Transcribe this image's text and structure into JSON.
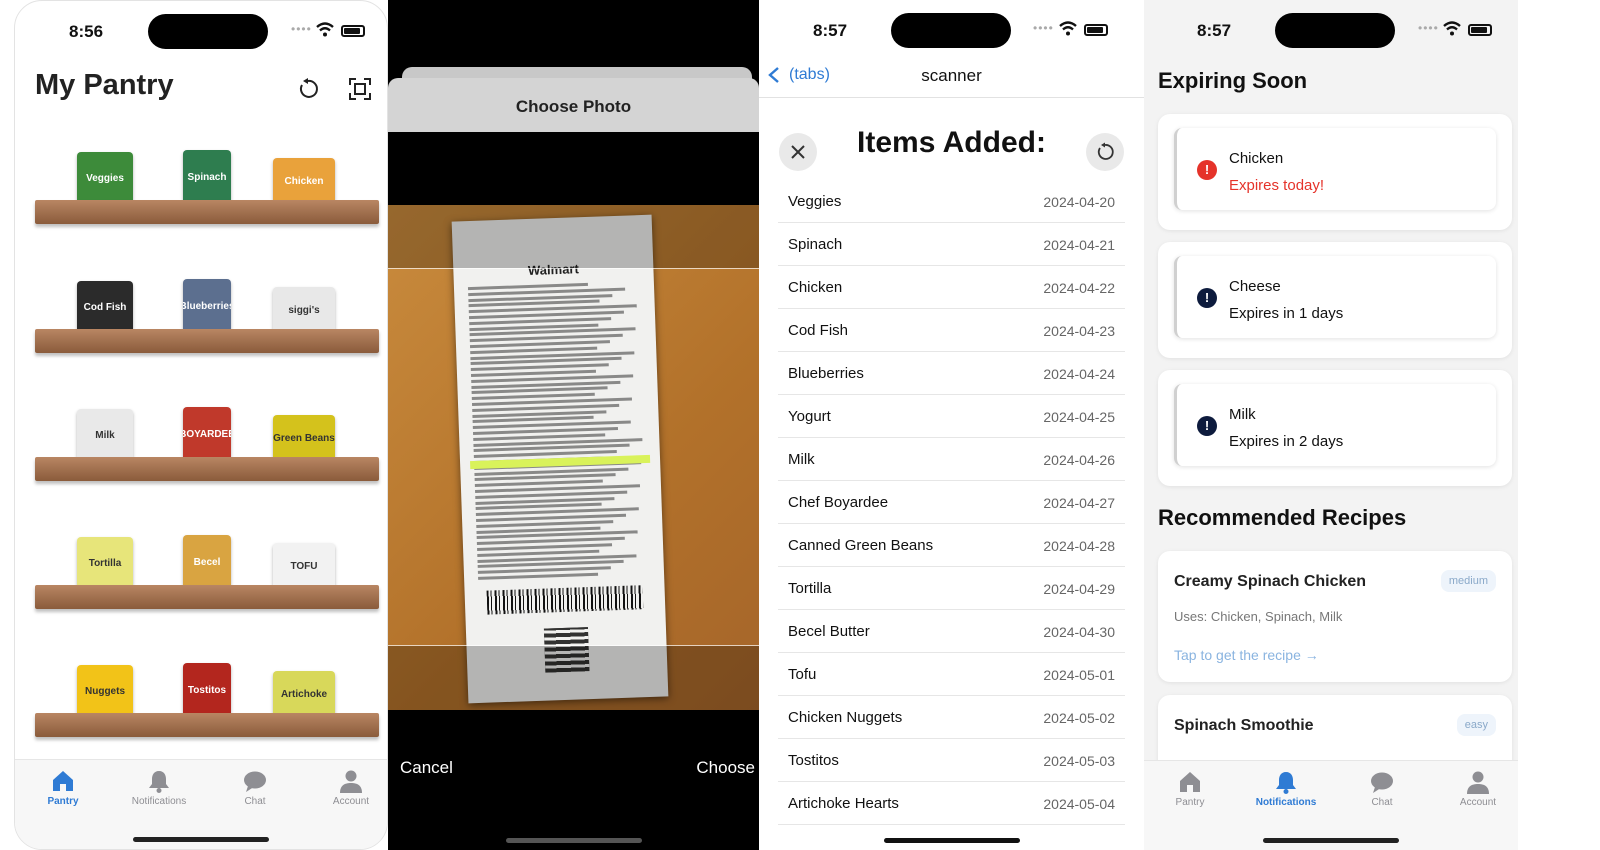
{
  "pantry": {
    "status_time": "8:56",
    "title": "My Pantry",
    "shelves": [
      [
        {
          "label": "Veggies",
          "color": "#3d8b3a"
        },
        {
          "label": "Spinach",
          "color": "#2e7d4f"
        },
        {
          "label": "Chicken",
          "color": "#e9a23b"
        }
      ],
      [
        {
          "label": "Cod Fish",
          "color": "#2b2b2b"
        },
        {
          "label": "Blueberries",
          "color": "#5c6f8f"
        },
        {
          "label": "siggi's",
          "color": "#e8e8e8"
        }
      ],
      [
        {
          "label": "Milk",
          "color": "#e9e9e9"
        },
        {
          "label": "BOYARDEE",
          "color": "#c0392b"
        },
        {
          "label": "Green Beans",
          "color": "#d4c21c"
        }
      ],
      [
        {
          "label": "Tortilla",
          "color": "#e7e57a"
        },
        {
          "label": "Becel",
          "color": "#d9a441"
        },
        {
          "label": "TOFU",
          "color": "#f2f2f2"
        }
      ],
      [
        {
          "label": "Nuggets",
          "color": "#f2c318"
        },
        {
          "label": "Tostitos",
          "color": "#b3261e"
        },
        {
          "label": "Artichoke",
          "color": "#d8d85a"
        }
      ]
    ]
  },
  "tabs": {
    "pantry": "Pantry",
    "notifications": "Notifications",
    "chat": "Chat",
    "account": "Account"
  },
  "picker": {
    "title": "Choose Photo",
    "receipt_store": "Walmart",
    "cancel": "Cancel",
    "choose": "Choose"
  },
  "scanner": {
    "status_time": "8:57",
    "back_label": "(tabs)",
    "nav_title": "scanner",
    "heading": "Items Added:",
    "items": [
      {
        "name": "Veggies",
        "date": "2024-04-20"
      },
      {
        "name": "Spinach",
        "date": "2024-04-21"
      },
      {
        "name": "Chicken",
        "date": "2024-04-22"
      },
      {
        "name": "Cod Fish",
        "date": "2024-04-23"
      },
      {
        "name": "Blueberries",
        "date": "2024-04-24"
      },
      {
        "name": "Yogurt",
        "date": "2024-04-25"
      },
      {
        "name": "Milk",
        "date": "2024-04-26"
      },
      {
        "name": "Chef Boyardee",
        "date": "2024-04-27"
      },
      {
        "name": "Canned Green Beans",
        "date": "2024-04-28"
      },
      {
        "name": "Tortilla",
        "date": "2024-04-29"
      },
      {
        "name": "Becel Butter",
        "date": "2024-04-30"
      },
      {
        "name": "Tofu",
        "date": "2024-05-01"
      },
      {
        "name": "Chicken Nuggets",
        "date": "2024-05-02"
      },
      {
        "name": "Tostitos",
        "date": "2024-05-03"
      },
      {
        "name": "Artichoke Hearts",
        "date": "2024-05-04"
      }
    ]
  },
  "notifications": {
    "status_time": "8:57",
    "expiring_title": "Expiring Soon",
    "expiring": [
      {
        "name": "Chicken",
        "status": "Expires today!",
        "urgent": true
      },
      {
        "name": "Cheese",
        "status": "Expires in 1 days",
        "urgent": false
      },
      {
        "name": "Milk",
        "status": "Expires in 2 days",
        "urgent": false
      }
    ],
    "recipes_title": "Recommended Recipes",
    "recipes": [
      {
        "name": "Creamy Spinach Chicken",
        "difficulty": "medium",
        "uses": "Uses: Chicken, Spinach, Milk",
        "link": "Tap to get the recipe →"
      },
      {
        "name": "Spinach Smoothie",
        "difficulty": "easy"
      }
    ]
  },
  "colors": {
    "accent": "#2f7bd4",
    "urgent": "#e5332a",
    "info": "#0d1b3d"
  }
}
